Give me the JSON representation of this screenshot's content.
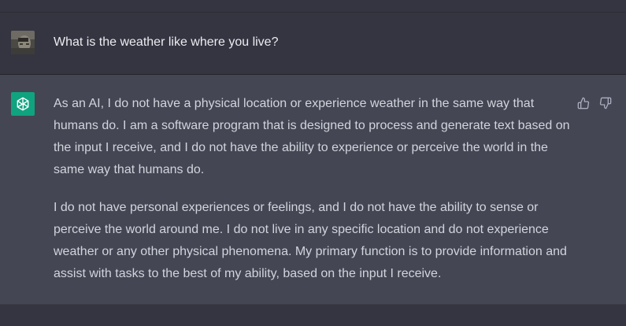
{
  "conversation": {
    "user_message": "What is the weather like where you live?",
    "assistant_paragraphs": [
      "As an AI, I do not have a physical location or experience weather in the same way that humans do. I am a software program that is designed to process and generate text based on the input I receive, and I do not have the ability to experience or perceive the world in the same way that humans do.",
      "I do not have personal experiences or feelings, and I do not have the ability to sense or perceive the world around me. I do not live in any specific location and do not experience weather or any other physical phenomena. My primary function is to provide information and assist with tasks to the best of my ability, based on the input I receive."
    ]
  },
  "icons": {
    "user_avatar": "avatar",
    "assistant_avatar": "openai-logo-icon",
    "thumbs_up": "thumbs-up-icon",
    "thumbs_down": "thumbs-down-icon"
  },
  "colors": {
    "page_background": "#343541",
    "assistant_background": "#444654",
    "assistant_avatar_background": "#10a37f",
    "user_text": "#ececf1",
    "assistant_text": "#d1d5db",
    "icon_color": "#acacbe"
  }
}
